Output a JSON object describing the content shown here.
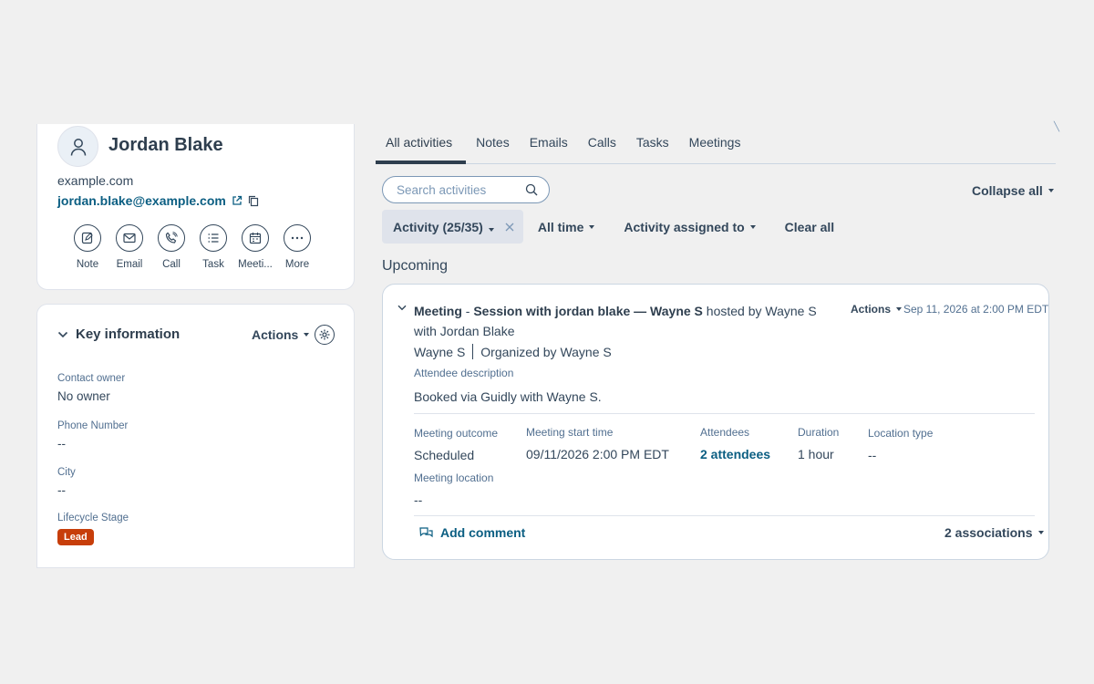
{
  "contact": {
    "name": "Jordan Blake",
    "domain": "example.com",
    "email": "jordan.blake@example.com",
    "quick_actions": [
      {
        "label": "Note",
        "icon": "note-icon"
      },
      {
        "label": "Email",
        "icon": "email-icon"
      },
      {
        "label": "Call",
        "icon": "call-icon"
      },
      {
        "label": "Task",
        "icon": "task-icon"
      },
      {
        "label": "Meeti...",
        "icon": "meeting-icon"
      },
      {
        "label": "More",
        "icon": "more-icon"
      }
    ]
  },
  "key_info": {
    "title": "Key information",
    "actions_label": "Actions",
    "properties": [
      {
        "label": "Contact owner",
        "value": "No owner"
      },
      {
        "label": "Phone Number",
        "value": "--"
      },
      {
        "label": "City",
        "value": "--"
      },
      {
        "label": "Lifecycle Stage",
        "value": "Lead"
      }
    ],
    "lead_color": "#c73e0a"
  },
  "tabs": [
    "All activities",
    "Notes",
    "Emails",
    "Calls",
    "Tasks",
    "Meetings"
  ],
  "search": {
    "placeholder": "Search activities"
  },
  "collapse_all": "Collapse all",
  "filters": {
    "activity": "Activity (25/35)",
    "time": "All time",
    "assigned": "Activity assigned to",
    "clear": "Clear all"
  },
  "section_label": "Upcoming",
  "meeting": {
    "type": "Meeting",
    "title_sep": " - ",
    "subject": "Session with jordan blake — Wayne S",
    "hosted": " hosted by Wayne S",
    "with": "with Jordan Blake",
    "actions_label": "Actions",
    "date": "Sep 11, 2026 at 2:00 PM EDT",
    "host": "Wayne S",
    "organizer": "Organized by Wayne S",
    "attendee_desc_label": "Attendee description",
    "attendee_desc": "Booked via Guidly with Wayne S.",
    "fields": {
      "outcome": {
        "label": "Meeting outcome",
        "value": "Scheduled"
      },
      "start": {
        "label": "Meeting start time",
        "value": "09/11/2026 2:00 PM EDT"
      },
      "attendees": {
        "label": "Attendees",
        "value": "2 attendees"
      },
      "duration": {
        "label": "Duration",
        "value": "1 hour"
      },
      "location_type": {
        "label": "Location type",
        "value": "--"
      },
      "location": {
        "label": "Meeting location",
        "value": "--"
      }
    },
    "add_comment": "Add comment",
    "associations": "2 associations"
  },
  "colors": {
    "link": "#0b5e82",
    "text": "#33475b",
    "background": "#f0f0f0"
  }
}
